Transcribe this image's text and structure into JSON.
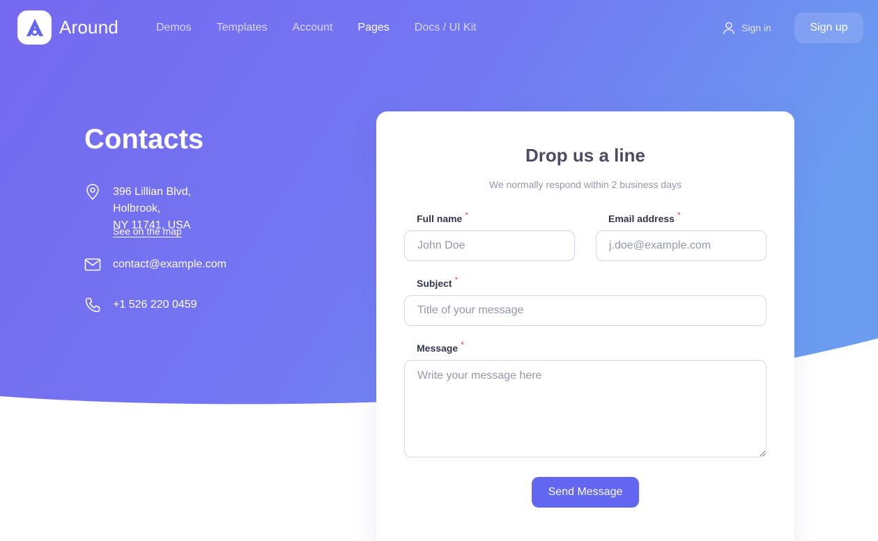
{
  "brand": {
    "name": "Around",
    "logo_icon": "around-logo-icon"
  },
  "nav": {
    "items": [
      {
        "label": "Demos",
        "active": false
      },
      {
        "label": "Templates",
        "active": false
      },
      {
        "label": "Account",
        "active": false
      },
      {
        "label": "Pages",
        "active": true
      },
      {
        "label": "Docs / UI Kit",
        "active": false
      }
    ],
    "signin_label": "Sign in",
    "signin_icon": "user-icon",
    "signup_label": "Sign up"
  },
  "contacts": {
    "title": "Contacts",
    "address_line1": "396 Lillian Blvd, Holbrook,",
    "address_line2": "NY 11741, USA",
    "map_link": "See on the map",
    "email": "contact@example.com",
    "phone": "+1 526 220 0459",
    "icons": [
      "map-pin-icon",
      "mail-icon",
      "phone-icon"
    ]
  },
  "form": {
    "title": "Drop us a line",
    "subtitle": "We normally respond within 2 business days",
    "required_mark": "*",
    "fullname": {
      "label": "Full name",
      "placeholder": "John Doe",
      "value": ""
    },
    "email": {
      "label": "Email address",
      "placeholder": "j.doe@example.com",
      "value": ""
    },
    "subject": {
      "label": "Subject",
      "placeholder": "Title of your message",
      "value": ""
    },
    "message": {
      "label": "Message",
      "placeholder": "Write your message here",
      "value": ""
    },
    "submit_label": "Send Message"
  },
  "colors": {
    "hero_gradient_start": "#7569f0",
    "hero_gradient_end": "#6c9cf0",
    "primary": "#6366f1",
    "required": "#ef4444"
  }
}
